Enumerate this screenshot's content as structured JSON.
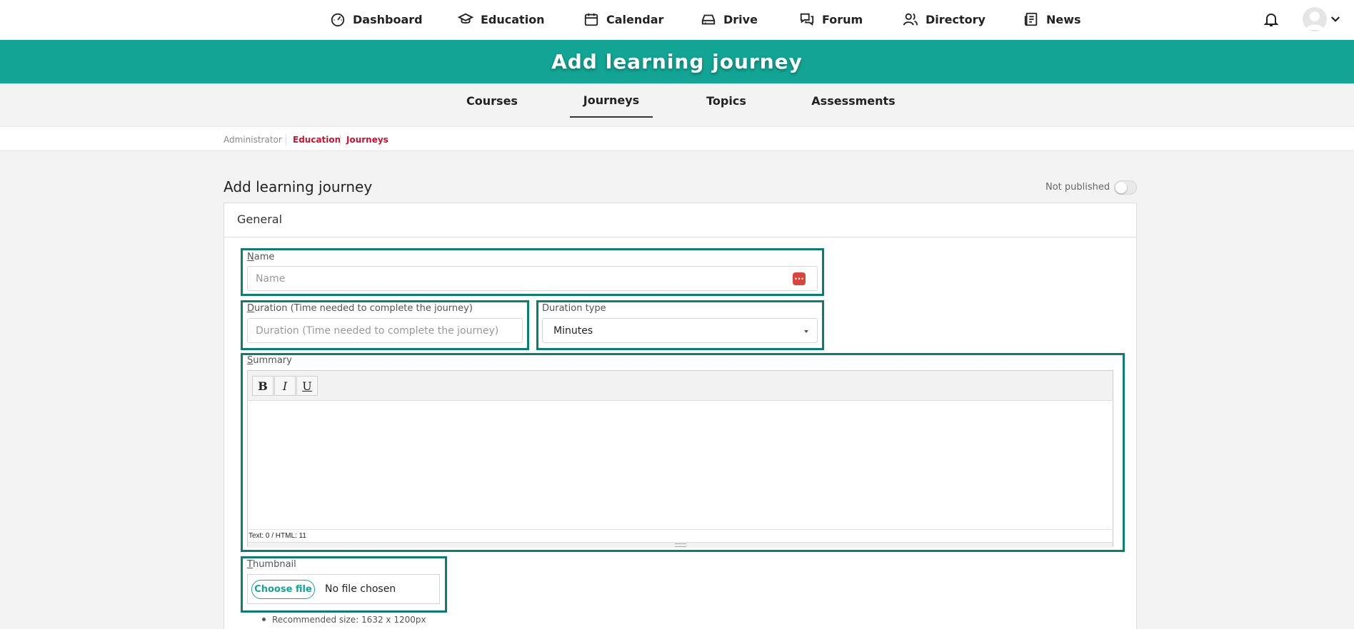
{
  "nav": {
    "items": [
      {
        "label": "Dashboard",
        "icon": "dashboard-gauge-icon"
      },
      {
        "label": "Education",
        "icon": "graduation-cap-icon"
      },
      {
        "label": "Calendar",
        "icon": "calendar-icon"
      },
      {
        "label": "Drive",
        "icon": "drive-icon"
      },
      {
        "label": "Forum",
        "icon": "forum-chat-icon"
      },
      {
        "label": "Directory",
        "icon": "people-icon"
      },
      {
        "label": "News",
        "icon": "news-icon"
      }
    ],
    "notification_icon": "bell-icon",
    "avatar_icon": "user-avatar-icon",
    "menu_icon": "chevron-down-icon"
  },
  "banner": {
    "title": "Add learning journey",
    "color": "#12a594"
  },
  "subtabs": {
    "items": [
      {
        "label": "Courses",
        "active": false
      },
      {
        "label": "Journeys",
        "active": true
      },
      {
        "label": "Topics",
        "active": false
      },
      {
        "label": "Assessments",
        "active": false
      }
    ]
  },
  "breadcrumb": [
    "Administrator",
    "Education",
    "Journeys"
  ],
  "page": {
    "title": "Add learning journey",
    "publish_label": "Not published",
    "published": false
  },
  "card": {
    "heading": "General"
  },
  "form": {
    "name": {
      "label_first": "N",
      "label_rest": "ame",
      "placeholder": "Name",
      "value": ""
    },
    "duration": {
      "label_first": "D",
      "label_rest": "uration (Time needed to complete the journey)",
      "placeholder": "Duration (Time needed to complete the journey)",
      "value": ""
    },
    "duration_type": {
      "label": "Duration type",
      "value": "Minutes"
    },
    "summary": {
      "label_first": "S",
      "label_rest": "ummary",
      "toolbar": {
        "bold": "B",
        "italic": "I",
        "underline": "U"
      },
      "status": "Text: 0 / HTML: 11"
    },
    "thumbnail": {
      "label_first": "T",
      "label_rest": "humbnail",
      "button": "Choose file",
      "file_status": "No file chosen",
      "hint": "Recommended size: 1632 x 1200px"
    }
  },
  "colors": {
    "accent": "#12a594",
    "breadcrumb_active": "#d0102e",
    "highlight": "#0a7e73",
    "password_manager": "#d9443d"
  }
}
